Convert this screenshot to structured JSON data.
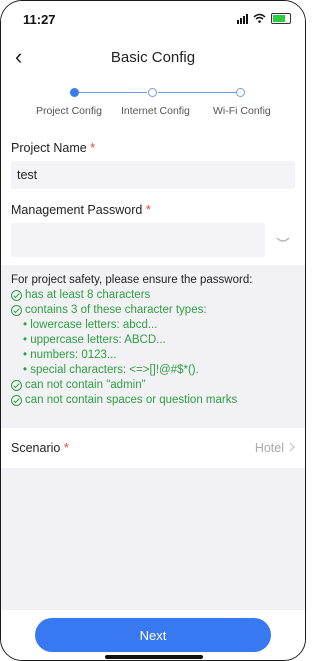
{
  "status": {
    "time": "11:27"
  },
  "nav": {
    "title": "Basic Config"
  },
  "steps": [
    {
      "label": "Project Config",
      "state": "active"
    },
    {
      "label": "Internet Config",
      "state": "pending"
    },
    {
      "label": "Wi-Fi Config",
      "state": "pending"
    }
  ],
  "form": {
    "project_name_label": "Project Name",
    "project_name_value": "test",
    "password_label": "Management Password",
    "password_value": "",
    "required_mark": "*"
  },
  "password_rules": {
    "intro": "For project safety, please ensure the password:",
    "r1": "has at least 8 characters",
    "r2": "contains 3 of these character types:",
    "types": [
      "lowercase letters: abcd...",
      "uppercase letters: ABCD...",
      "numbers: 0123...",
      "special characters: <=>[]!@#$*()."
    ],
    "r3": "can not contain \"admin\"",
    "r4": "can not contain spaces or question marks"
  },
  "scenario": {
    "label": "Scenario",
    "value": "Hotel"
  },
  "footer": {
    "next_label": "Next"
  },
  "colors": {
    "accent": "#3878f0",
    "valid": "#2f9d46",
    "required": "#e8413a"
  }
}
